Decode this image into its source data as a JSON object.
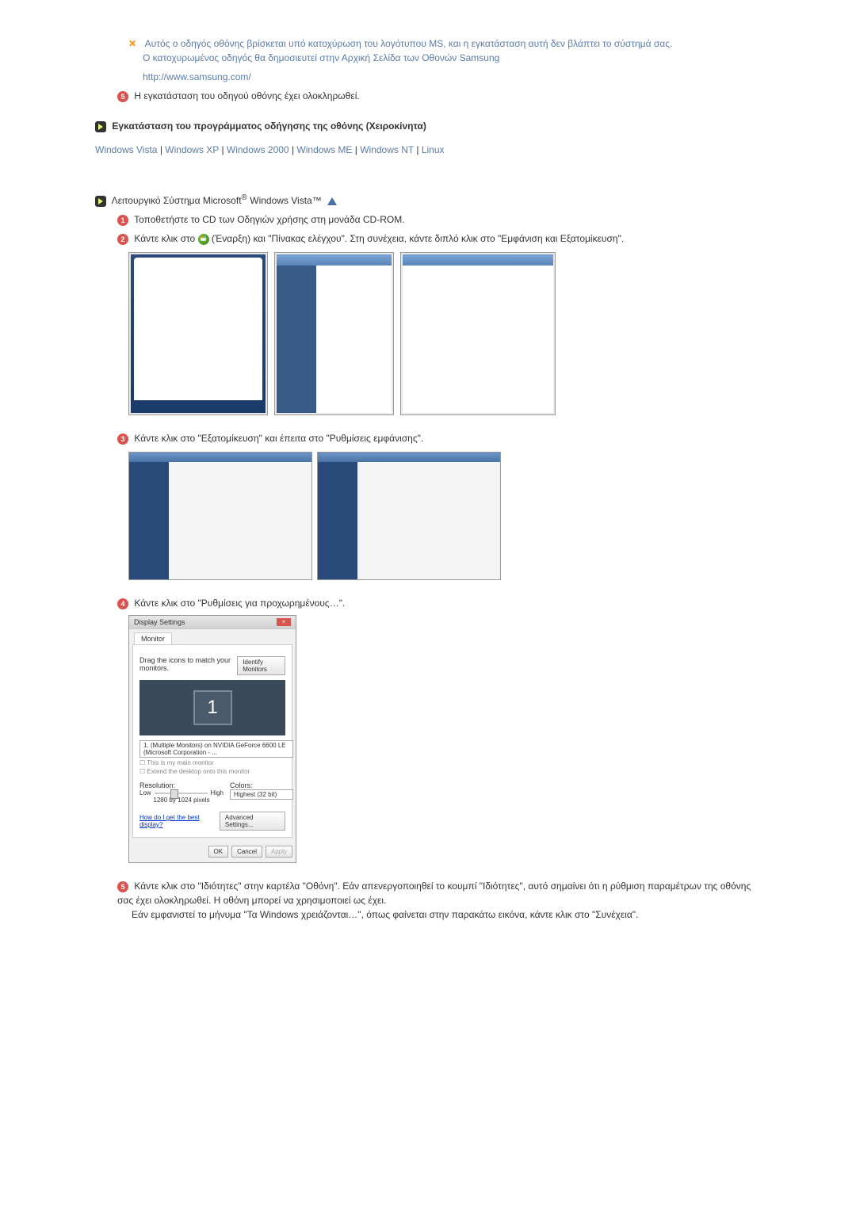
{
  "note": {
    "line1": "Αυτός ο οδηγός οθόνης βρίσκεται υπό κατοχύρωση του λογότυπου MS, και η εγκατάσταση αυτή δεν βλάπτει το σύστημά σας.",
    "line2": "Ο κατοχυρωμένος οδηγός θα δημοσιευτεί στην Αρχική Σελίδα των Οθονών Samsung",
    "url": "http://www.samsung.com/"
  },
  "step5": "Η εγκατάσταση του οδηγού οθόνης έχει ολοκληρωθεί.",
  "manual_install_header": "Εγκατάσταση του προγράμματος οδήγησης της οθόνης (Χειροκίνητα)",
  "os_links": {
    "vista": "Windows Vista",
    "xp": "Windows XP",
    "w2000": "Windows 2000",
    "me": "Windows ME",
    "nt": "Windows NT",
    "linux": "Linux"
  },
  "vista_header": "Λειτουργικό Σύστημα Microsoft",
  "vista_suffix": " Windows Vista™",
  "steps": {
    "s1": "Τοποθετήστε το CD των Οδηγιών χρήσης στη μονάδα CD-ROM.",
    "s2a": "Κάντε κλικ στο ",
    "s2b": "(Έναρξη) και \"Πίνακας ελέγχου\". Στη συνέχεια, κάντε διπλό κλικ στο \"Εμφάνιση και Εξατομίκευση\".",
    "s3": "Κάντε κλικ στο \"Εξατομίκευση\" και έπειτα στο \"Ρυθμίσεις εμφάνισης\".",
    "s4": "Κάντε κλικ στο \"Ρυθμίσεις για προχωρημένους…\".",
    "s5": "Κάντε κλικ στο \"Ιδιότητες\" στην καρτέλα \"Οθόνη\". Εάν απενεργοποιηθεί το κουμπί \"Ιδιότητες\", αυτό σημαίνει ότι η ρύθμιση παραμέτρων της οθόνης σας έχει ολοκληρωθεί. Η οθόνη μπορεί να χρησιμοποιεί ως έχει.",
    "s5b": "Εάν εμφανιστεί το μήνυμα \"Τα Windows χρειάζονται…\", όπως φαίνεται στην παρακάτω εικόνα, κάντε κλικ στο \"Συνέχεια\"."
  },
  "display_settings": {
    "title": "Display Settings",
    "tab": "Monitor",
    "drag_text": "Drag the icons to match your monitors.",
    "identify": "Identify Monitors",
    "monitor_select": "1. (Multiple Monitors) on NVIDIA GeForce 6600 LE (Microsoft Corporation - ...",
    "chk1": "This is my main monitor",
    "chk2": "Extend the desktop onto this monitor",
    "resolution_label": "Resolution:",
    "low": "Low",
    "high": "High",
    "res_value": "1280 by 1024 pixels",
    "colors_label": "Colors:",
    "colors_value": "Highest (32 bit)",
    "help_link": "How do I get the best display?",
    "advanced": "Advanced Settings...",
    "ok": "OK",
    "cancel": "Cancel",
    "apply": "Apply"
  }
}
